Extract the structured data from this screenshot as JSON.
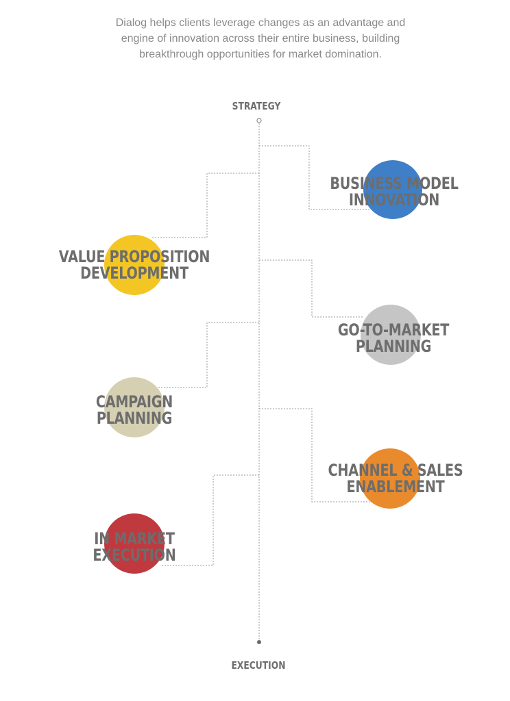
{
  "intro": {
    "line1": "Dialog helps clients leverage changes as an advantage and",
    "line2": "engine of innovation across their entire business, building",
    "line3": "breakthrough opportunities for market domination."
  },
  "axis": {
    "top_label": "STRATEGY",
    "bottom_label": "EXECUTION"
  },
  "nodes": [
    {
      "id": "business-model-innovation",
      "line1": "BUSINESS MODEL",
      "line2": "INNOVATION",
      "color": "#3f7fc8",
      "side": "right"
    },
    {
      "id": "value-proposition-development",
      "line1": "VALUE PROPOSITION",
      "line2": "DEVELOPMENT",
      "color": "#f3c623",
      "side": "left"
    },
    {
      "id": "go-to-market-planning",
      "line1": "GO-TO-MARKET",
      "line2": "PLANNING",
      "color": "#c5c5c5",
      "side": "right"
    },
    {
      "id": "campaign-planning",
      "line1": "CAMPAIGN",
      "line2": "PLANNING",
      "color": "#d6d0b2",
      "side": "left"
    },
    {
      "id": "channel-sales-enablement",
      "line1": "CHANNEL & SALES",
      "line2": "ENABLEMENT",
      "color": "#e98b2c",
      "side": "right"
    },
    {
      "id": "in-market-execution",
      "line1": "IN MARKET",
      "line2": "EXECUTION",
      "color": "#c0393f",
      "side": "left"
    }
  ]
}
